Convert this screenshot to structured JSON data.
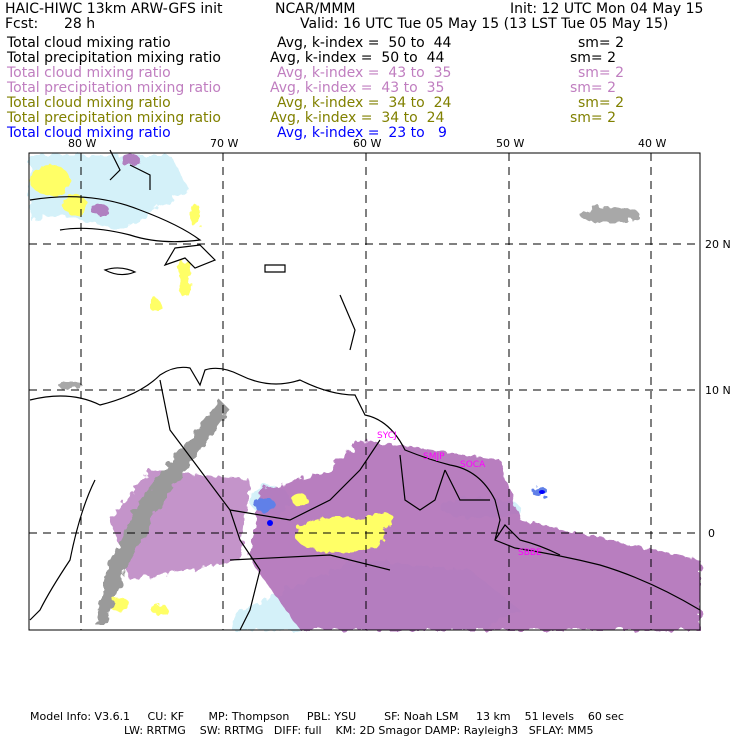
{
  "header": {
    "title": "HAIC-HIWC 13km ARW-GFS init",
    "org": "NCAR/MMM",
    "init": "Init: 12 UTC Mon 04 May 15",
    "fcst_label": "Fcst:",
    "fcst_value": "28 h",
    "valid": "Valid: 16 UTC Tue 05 May 15 (13 LST Tue 05 May 15)"
  },
  "fields": [
    {
      "name": "Total cloud mixing ratio",
      "avg": "Avg, k-index =  50 to  44",
      "sm": "sm= 2",
      "color": "#000000"
    },
    {
      "name": "Total precipitation mixing ratio",
      "avg": "Avg, k-index =  50 to  44",
      "sm": "sm= 2",
      "color": "#000000"
    },
    {
      "name": "Total cloud mixing ratio",
      "avg": "Avg, k-index =  43 to  35",
      "sm": "sm= 2",
      "color": "#c07ec0"
    },
    {
      "name": "Total precipitation mixing ratio",
      "avg": "Avg, k-index =  43 to  35",
      "sm": "sm= 2",
      "color": "#c07ec0"
    },
    {
      "name": "Total cloud mixing ratio",
      "avg": "Avg, k-index =  34 to  24",
      "sm": "sm= 2",
      "color": "#808000"
    },
    {
      "name": "Total precipitation mixing ratio",
      "avg": "Avg, k-index =  34 to  24",
      "sm": "sm= 2",
      "color": "#808000"
    },
    {
      "name": "Total cloud mixing ratio",
      "avg": "Avg, k-index =  23 to   9",
      "color": "#0000ff"
    }
  ],
  "map": {
    "lon_labels": [
      "80 W",
      "70 W",
      "60 W",
      "50 W",
      "40 W"
    ],
    "lat_labels": [
      "20 N",
      "10 N",
      "0"
    ],
    "stations": [
      "SYCJ",
      "SMJP",
      "SOCA",
      "SBBE"
    ]
  },
  "footer": {
    "line1": "Model Info: V3.6.1     CU: KF       MP: Thompson     PBL: YSU        SF: Noah LSM     13 km    51 levels    60 sec",
    "line2": "LW: RRTMG    SW: RRTMG   DIFF: full    KM: 2D Smagor DAMP: Rayleigh3   SFLAY: MM5"
  }
}
